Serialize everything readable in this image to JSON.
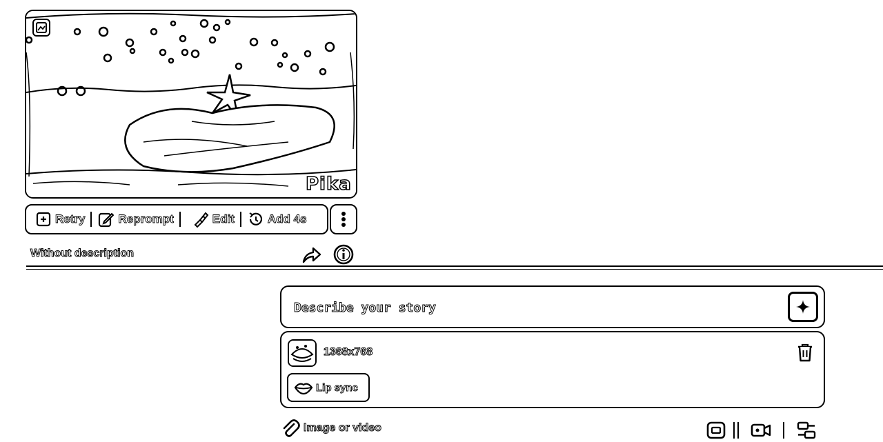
{
  "video": {
    "watermark": "Pika",
    "icons": [
      "image-icon"
    ]
  },
  "actions": {
    "retry": "Retry",
    "reprompt": "Reprompt",
    "edit": "Edit",
    "add4s": "Add 4s",
    "more_icon": "more-vertical-icon"
  },
  "meta": {
    "description": "Without description",
    "share_icon": "share-icon",
    "info_icon": "info-icon"
  },
  "prompt": {
    "placeholder": "Describe your story",
    "value": "",
    "submit_icon": "sparkle-icon"
  },
  "attachment": {
    "resolution": "1368x768",
    "lip_sync": "Lip sync",
    "delete_icon": "trash-icon"
  },
  "toolbar": {
    "image_or_video": "Image or video",
    "icons": [
      "frame-icon",
      "camera-icon",
      "settings-icon"
    ]
  }
}
